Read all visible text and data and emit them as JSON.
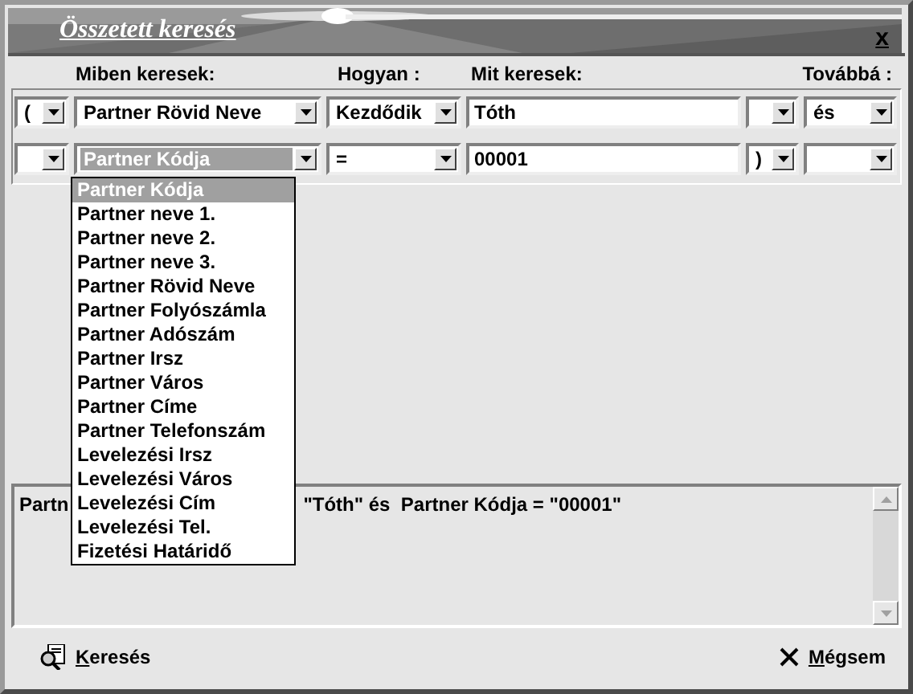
{
  "window": {
    "title": "Összetett keresés",
    "close": "x"
  },
  "columns": [
    "Miben keresek:",
    "Hogyan :",
    "Mit keresek:",
    "Továbbá :"
  ],
  "rows": [
    {
      "open_paren": "(",
      "field": "Partner Rövid Neve",
      "field_selected": false,
      "operator": "Kezdődik",
      "value": "Tóth",
      "next": "és"
    },
    {
      "field": "Partner Kódja",
      "field_selected": true,
      "operator": "=",
      "value": "00001",
      "close_paren": ")"
    }
  ],
  "dropdown": {
    "items": [
      {
        "label": "Partner Kódja",
        "selected": true
      },
      {
        "label": "Partner neve 1.",
        "selected": false
      },
      {
        "label": "Partner neve 2.",
        "selected": false
      },
      {
        "label": "Partner neve 3.",
        "selected": false
      },
      {
        "label": "Partner Rövid Neve",
        "selected": false
      },
      {
        "label": "Partner Folyószámla",
        "selected": false
      },
      {
        "label": "Partner Adószám",
        "selected": false
      },
      {
        "label": "Partner Irsz",
        "selected": false
      },
      {
        "label": "Partner Város",
        "selected": false
      },
      {
        "label": "Partner Címe",
        "selected": false
      },
      {
        "label": "Partner Telefonszám",
        "selected": false
      },
      {
        "label": "Levelezési Irsz",
        "selected": false
      },
      {
        "label": "Levelezési Város",
        "selected": false
      },
      {
        "label": "Levelezési Cím",
        "selected": false
      },
      {
        "label": "Levelezési Tel.",
        "selected": false
      },
      {
        "label": "Fizetési Határidő",
        "selected": false
      }
    ]
  },
  "query_text": [
    "Partn",
    "\"Tóth\" és  Partner Kódja = \"00001\""
  ],
  "buttons": [
    {
      "label": "Keresés",
      "kind": "search"
    },
    {
      "label": "Mégsem",
      "kind": "cancel"
    }
  ]
}
